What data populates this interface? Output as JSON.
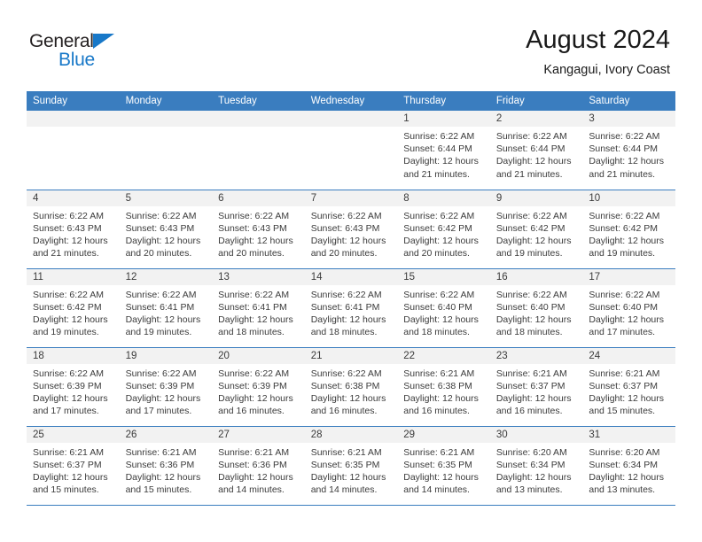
{
  "brand": {
    "line1": "General",
    "line2": "Blue",
    "triangle_color": "#1878c8"
  },
  "header": {
    "title": "August 2024",
    "subtitle": "Kangagui, Ivory Coast"
  },
  "theme": {
    "header_blue": "#3a7dbf",
    "daynum_band": "#f2f2f2",
    "text": "#3b3b3b"
  },
  "weekday_headers": [
    "Sunday",
    "Monday",
    "Tuesday",
    "Wednesday",
    "Thursday",
    "Friday",
    "Saturday"
  ],
  "weeks": [
    [
      {
        "day": "",
        "empty": true
      },
      {
        "day": "",
        "empty": true
      },
      {
        "day": "",
        "empty": true
      },
      {
        "day": "",
        "empty": true
      },
      {
        "day": "1",
        "sunrise": "Sunrise: 6:22 AM",
        "sunset": "Sunset: 6:44 PM",
        "daylight1": "Daylight: 12 hours",
        "daylight2": "and 21 minutes."
      },
      {
        "day": "2",
        "sunrise": "Sunrise: 6:22 AM",
        "sunset": "Sunset: 6:44 PM",
        "daylight1": "Daylight: 12 hours",
        "daylight2": "and 21 minutes."
      },
      {
        "day": "3",
        "sunrise": "Sunrise: 6:22 AM",
        "sunset": "Sunset: 6:44 PM",
        "daylight1": "Daylight: 12 hours",
        "daylight2": "and 21 minutes."
      }
    ],
    [
      {
        "day": "4",
        "sunrise": "Sunrise: 6:22 AM",
        "sunset": "Sunset: 6:43 PM",
        "daylight1": "Daylight: 12 hours",
        "daylight2": "and 21 minutes."
      },
      {
        "day": "5",
        "sunrise": "Sunrise: 6:22 AM",
        "sunset": "Sunset: 6:43 PM",
        "daylight1": "Daylight: 12 hours",
        "daylight2": "and 20 minutes."
      },
      {
        "day": "6",
        "sunrise": "Sunrise: 6:22 AM",
        "sunset": "Sunset: 6:43 PM",
        "daylight1": "Daylight: 12 hours",
        "daylight2": "and 20 minutes."
      },
      {
        "day": "7",
        "sunrise": "Sunrise: 6:22 AM",
        "sunset": "Sunset: 6:43 PM",
        "daylight1": "Daylight: 12 hours",
        "daylight2": "and 20 minutes."
      },
      {
        "day": "8",
        "sunrise": "Sunrise: 6:22 AM",
        "sunset": "Sunset: 6:42 PM",
        "daylight1": "Daylight: 12 hours",
        "daylight2": "and 20 minutes."
      },
      {
        "day": "9",
        "sunrise": "Sunrise: 6:22 AM",
        "sunset": "Sunset: 6:42 PM",
        "daylight1": "Daylight: 12 hours",
        "daylight2": "and 19 minutes."
      },
      {
        "day": "10",
        "sunrise": "Sunrise: 6:22 AM",
        "sunset": "Sunset: 6:42 PM",
        "daylight1": "Daylight: 12 hours",
        "daylight2": "and 19 minutes."
      }
    ],
    [
      {
        "day": "11",
        "sunrise": "Sunrise: 6:22 AM",
        "sunset": "Sunset: 6:42 PM",
        "daylight1": "Daylight: 12 hours",
        "daylight2": "and 19 minutes."
      },
      {
        "day": "12",
        "sunrise": "Sunrise: 6:22 AM",
        "sunset": "Sunset: 6:41 PM",
        "daylight1": "Daylight: 12 hours",
        "daylight2": "and 19 minutes."
      },
      {
        "day": "13",
        "sunrise": "Sunrise: 6:22 AM",
        "sunset": "Sunset: 6:41 PM",
        "daylight1": "Daylight: 12 hours",
        "daylight2": "and 18 minutes."
      },
      {
        "day": "14",
        "sunrise": "Sunrise: 6:22 AM",
        "sunset": "Sunset: 6:41 PM",
        "daylight1": "Daylight: 12 hours",
        "daylight2": "and 18 minutes."
      },
      {
        "day": "15",
        "sunrise": "Sunrise: 6:22 AM",
        "sunset": "Sunset: 6:40 PM",
        "daylight1": "Daylight: 12 hours",
        "daylight2": "and 18 minutes."
      },
      {
        "day": "16",
        "sunrise": "Sunrise: 6:22 AM",
        "sunset": "Sunset: 6:40 PM",
        "daylight1": "Daylight: 12 hours",
        "daylight2": "and 18 minutes."
      },
      {
        "day": "17",
        "sunrise": "Sunrise: 6:22 AM",
        "sunset": "Sunset: 6:40 PM",
        "daylight1": "Daylight: 12 hours",
        "daylight2": "and 17 minutes."
      }
    ],
    [
      {
        "day": "18",
        "sunrise": "Sunrise: 6:22 AM",
        "sunset": "Sunset: 6:39 PM",
        "daylight1": "Daylight: 12 hours",
        "daylight2": "and 17 minutes."
      },
      {
        "day": "19",
        "sunrise": "Sunrise: 6:22 AM",
        "sunset": "Sunset: 6:39 PM",
        "daylight1": "Daylight: 12 hours",
        "daylight2": "and 17 minutes."
      },
      {
        "day": "20",
        "sunrise": "Sunrise: 6:22 AM",
        "sunset": "Sunset: 6:39 PM",
        "daylight1": "Daylight: 12 hours",
        "daylight2": "and 16 minutes."
      },
      {
        "day": "21",
        "sunrise": "Sunrise: 6:22 AM",
        "sunset": "Sunset: 6:38 PM",
        "daylight1": "Daylight: 12 hours",
        "daylight2": "and 16 minutes."
      },
      {
        "day": "22",
        "sunrise": "Sunrise: 6:21 AM",
        "sunset": "Sunset: 6:38 PM",
        "daylight1": "Daylight: 12 hours",
        "daylight2": "and 16 minutes."
      },
      {
        "day": "23",
        "sunrise": "Sunrise: 6:21 AM",
        "sunset": "Sunset: 6:37 PM",
        "daylight1": "Daylight: 12 hours",
        "daylight2": "and 16 minutes."
      },
      {
        "day": "24",
        "sunrise": "Sunrise: 6:21 AM",
        "sunset": "Sunset: 6:37 PM",
        "daylight1": "Daylight: 12 hours",
        "daylight2": "and 15 minutes."
      }
    ],
    [
      {
        "day": "25",
        "sunrise": "Sunrise: 6:21 AM",
        "sunset": "Sunset: 6:37 PM",
        "daylight1": "Daylight: 12 hours",
        "daylight2": "and 15 minutes."
      },
      {
        "day": "26",
        "sunrise": "Sunrise: 6:21 AM",
        "sunset": "Sunset: 6:36 PM",
        "daylight1": "Daylight: 12 hours",
        "daylight2": "and 15 minutes."
      },
      {
        "day": "27",
        "sunrise": "Sunrise: 6:21 AM",
        "sunset": "Sunset: 6:36 PM",
        "daylight1": "Daylight: 12 hours",
        "daylight2": "and 14 minutes."
      },
      {
        "day": "28",
        "sunrise": "Sunrise: 6:21 AM",
        "sunset": "Sunset: 6:35 PM",
        "daylight1": "Daylight: 12 hours",
        "daylight2": "and 14 minutes."
      },
      {
        "day": "29",
        "sunrise": "Sunrise: 6:21 AM",
        "sunset": "Sunset: 6:35 PM",
        "daylight1": "Daylight: 12 hours",
        "daylight2": "and 14 minutes."
      },
      {
        "day": "30",
        "sunrise": "Sunrise: 6:20 AM",
        "sunset": "Sunset: 6:34 PM",
        "daylight1": "Daylight: 12 hours",
        "daylight2": "and 13 minutes."
      },
      {
        "day": "31",
        "sunrise": "Sunrise: 6:20 AM",
        "sunset": "Sunset: 6:34 PM",
        "daylight1": "Daylight: 12 hours",
        "daylight2": "and 13 minutes."
      }
    ]
  ]
}
